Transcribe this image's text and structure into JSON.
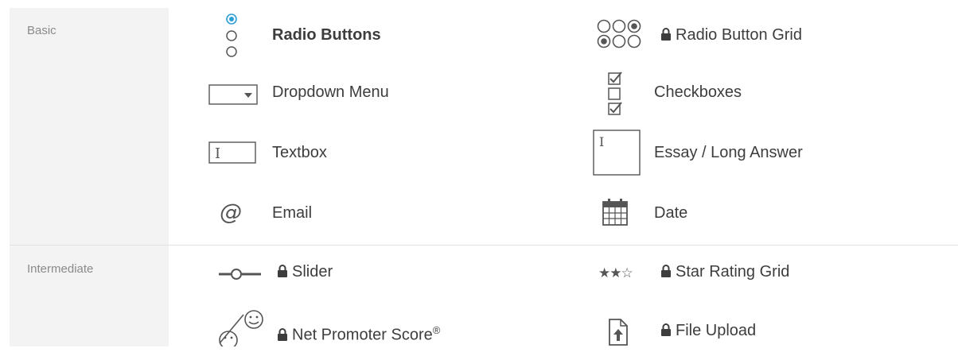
{
  "sections": [
    {
      "label": "Basic"
    },
    {
      "label": "Intermediate"
    }
  ],
  "items": {
    "radio_buttons": {
      "label": "Radio Buttons",
      "locked": false,
      "icon": "radio-buttons-icon"
    },
    "radio_button_grid": {
      "label": "Radio Button Grid",
      "locked": true,
      "icon": "radio-grid-icon"
    },
    "dropdown_menu": {
      "label": "Dropdown Menu",
      "locked": false,
      "icon": "dropdown-icon"
    },
    "checkboxes": {
      "label": "Checkboxes",
      "locked": false,
      "icon": "checkboxes-icon"
    },
    "textbox": {
      "label": "Textbox",
      "locked": false,
      "icon": "textbox-icon"
    },
    "essay": {
      "label": "Essay / Long Answer",
      "locked": false,
      "icon": "essay-icon"
    },
    "email": {
      "label": "Email",
      "locked": false,
      "icon": "at-icon"
    },
    "date": {
      "label": "Date",
      "locked": false,
      "icon": "calendar-icon"
    },
    "slider": {
      "label": "Slider",
      "locked": true,
      "icon": "slider-icon"
    },
    "star_rating_grid": {
      "label": "Star Rating Grid",
      "locked": true,
      "icon": "stars-icon"
    },
    "nps": {
      "label": "Net Promoter Score",
      "sup": "®",
      "locked": true,
      "icon": "nps-faces-icon"
    },
    "file_upload": {
      "label": "File Upload",
      "locked": true,
      "icon": "file-upload-icon"
    }
  },
  "colors": {
    "accent": "#2a9fd6",
    "icon": "#555555",
    "sidebar": "#f3f3f3"
  }
}
